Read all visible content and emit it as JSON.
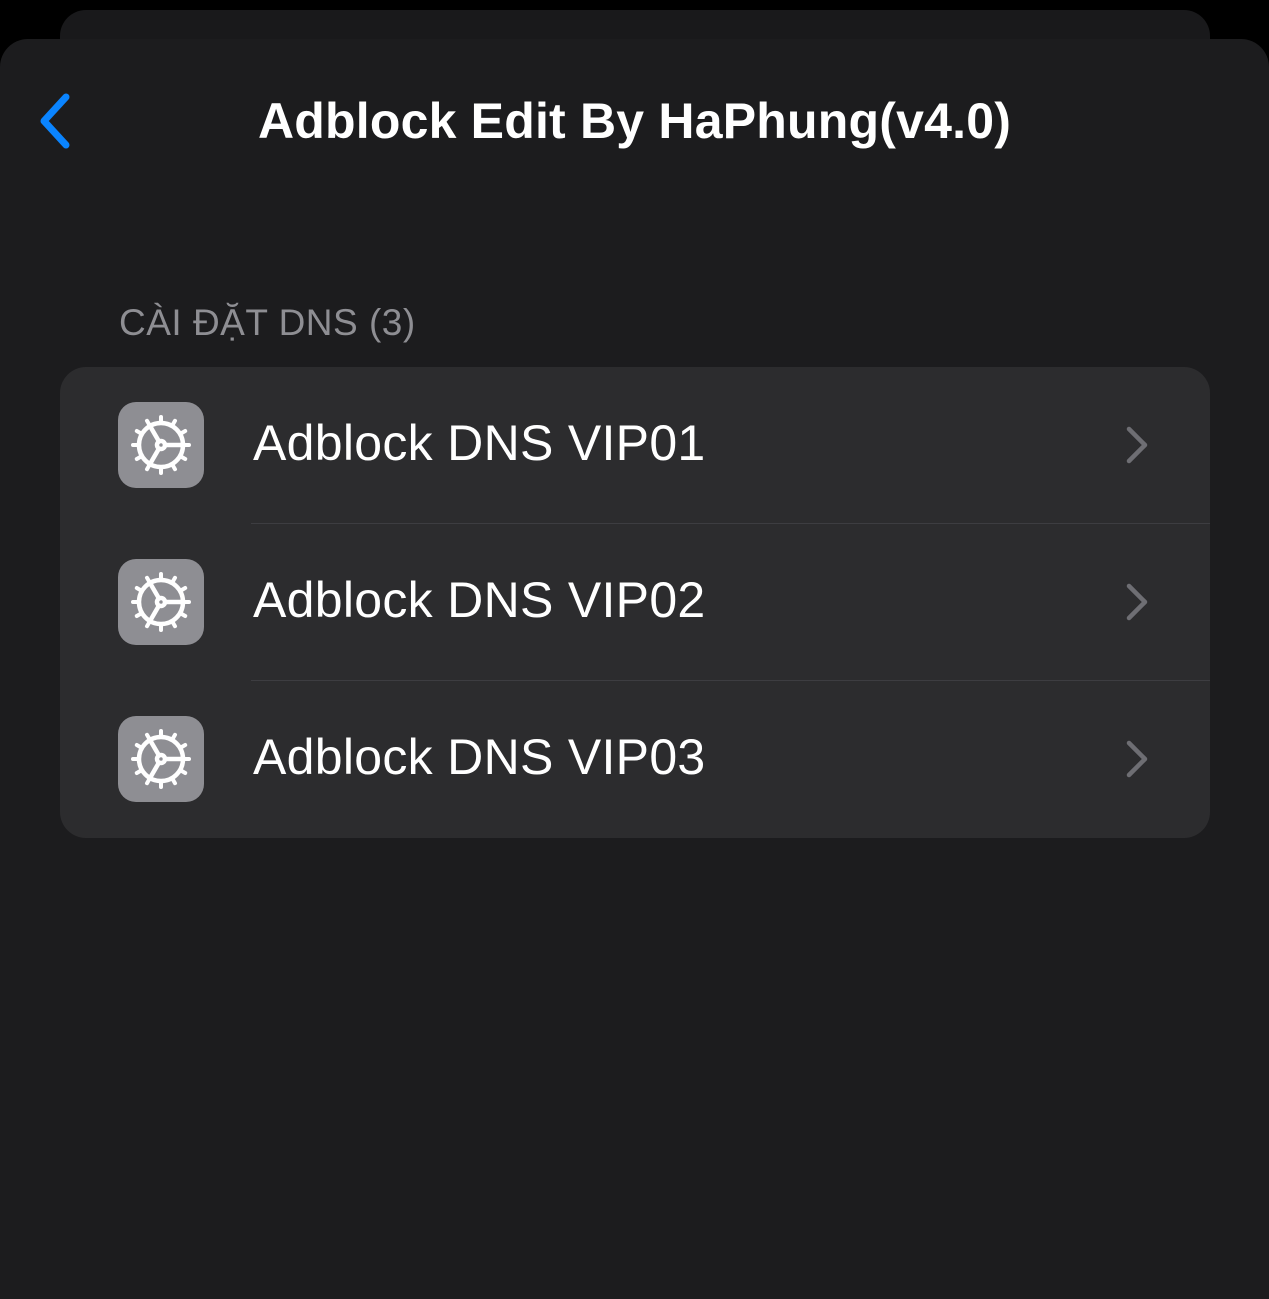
{
  "nav": {
    "back_icon": "chevron-left-icon",
    "title": "Adblock Edit By HaPhung(v4.0)",
    "accent_color": "#0a84ff"
  },
  "section": {
    "header": "CÀI ĐẶT DNS (3)"
  },
  "rows": [
    {
      "label": "Adblock DNS VIP01",
      "icon": "settings-gear-icon",
      "accessory": "chevron-right-icon"
    },
    {
      "label": "Adblock DNS VIP02",
      "icon": "settings-gear-icon",
      "accessory": "chevron-right-icon"
    },
    {
      "label": "Adblock DNS VIP03",
      "icon": "settings-gear-icon",
      "accessory": "chevron-right-icon"
    }
  ],
  "colors": {
    "background": "#1c1c1e",
    "group_background": "#2c2c2e",
    "icon_tile": "#8e8e93",
    "secondary_text": "#8e8e93"
  }
}
